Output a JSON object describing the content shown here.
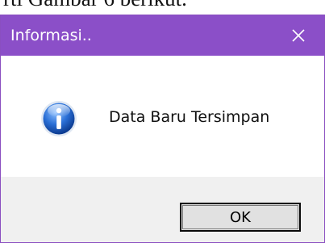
{
  "background_text": "rti Gambar 6 berikut.",
  "dialog": {
    "title": "Informasi..",
    "close_icon": "close-icon",
    "message": "Data Baru Tersimpan",
    "icon": "information-icon",
    "ok_label": "OK"
  },
  "colors": {
    "titlebar": "#8b4fc8",
    "footer": "#f0f0f0",
    "icon_blue": "#1f5fc8"
  }
}
